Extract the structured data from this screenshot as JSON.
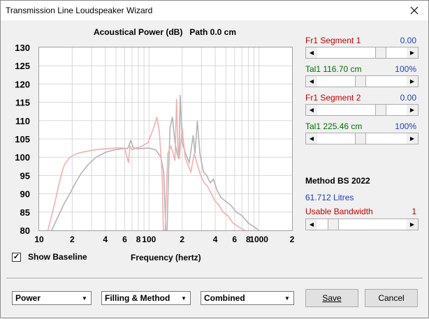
{
  "window": {
    "title": "Transmission Line Loudspeaker Wizard"
  },
  "chart_title": "Acoustical Power (dB)   Path 0.0 cm",
  "sidebar": {
    "seg1": {
      "label": "Fr1  Segment 1",
      "value": "0.00",
      "slider": 0.74
    },
    "tal1": {
      "label": "Tal1  116.70 cm",
      "value": "100%",
      "slider": 0.48
    },
    "seg2": {
      "label": "Fr1  Segment 2",
      "value": "0.00",
      "slider": 0.74
    },
    "tal2": {
      "label": "Tal1  225.46 cm",
      "value": "100%",
      "slider": 0.48
    },
    "method": "Method BS  2022",
    "litres": "61.712 Litres",
    "bandwidth": {
      "label": "Usable Bandwidth",
      "value": "1",
      "slider": 0.13
    }
  },
  "checkbox": {
    "label": "Show Baseline",
    "checked": true,
    "mark": "✓"
  },
  "xlabel": "Frequency (hertz)",
  "combos": {
    "power": "Power",
    "filling": "Filling & Method",
    "combined": "Combined"
  },
  "buttons": {
    "save": "Save",
    "cancel": "Cancel"
  },
  "icons": {
    "close": "close-icon",
    "dropdown": "dropdown-arrow-icon",
    "left": "arrow-left-icon",
    "right": "arrow-right-icon"
  },
  "colors": {
    "series_pink": "#f2b0b0",
    "series_gray": "#b4b4b4",
    "grid": "#d8d8d8"
  },
  "chart_data": {
    "type": "line",
    "title": "Acoustical Power (dB)   Path 0.0 cm",
    "xlabel": "Frequency (hertz)",
    "ylabel": "",
    "xscale": "log",
    "xlim": [
      10,
      2000
    ],
    "ylim": [
      80,
      130
    ],
    "grid": true,
    "y_ticks": [
      80,
      85,
      90,
      95,
      100,
      105,
      110,
      115,
      120,
      125,
      130
    ],
    "x_ticks": [
      {
        "value": 10,
        "label": "10"
      },
      {
        "value": 20,
        "label": "2"
      },
      {
        "value": 40,
        "label": "4"
      },
      {
        "value": 60,
        "label": "6"
      },
      {
        "value": 80,
        "label": "8"
      },
      {
        "value": 100,
        "label": "100"
      },
      {
        "value": 200,
        "label": "2"
      },
      {
        "value": 400,
        "label": "4"
      },
      {
        "value": 600,
        "label": "6"
      },
      {
        "value": 800,
        "label": "8"
      },
      {
        "value": 1000,
        "label": "1000"
      },
      {
        "value": 2000,
        "label": "2"
      }
    ],
    "series": [
      {
        "color": "#b4b4b4",
        "x": [
          13,
          15,
          17,
          19,
          21,
          24,
          28,
          33,
          40,
          48,
          57,
          64,
          68,
          72,
          78,
          88,
          100,
          115,
          128,
          136,
          142,
          146,
          150,
          155,
          163,
          172,
          180,
          187,
          192,
          200,
          215,
          232,
          252,
          262,
          275,
          290,
          312,
          335,
          360,
          385,
          415,
          450,
          495,
          550,
          620,
          700,
          800,
          900,
          1000
        ],
        "y": [
          80,
          84,
          87.5,
          90,
          92.5,
          95.5,
          98,
          100,
          101.3,
          102,
          102.3,
          102.4,
          104.5,
          102.6,
          102.3,
          102.4,
          102.5,
          102,
          100,
          96,
          80,
          80,
          94,
          108,
          111,
          104,
          101,
          99.5,
          117,
          104,
          101,
          98.5,
          106,
          101,
          110,
          101,
          96,
          95,
          93,
          94,
          91,
          89,
          88,
          87,
          85,
          84,
          82,
          81,
          80
        ]
      },
      {
        "color": "#f2b0b0",
        "x": [
          12,
          13,
          14,
          15,
          16,
          17,
          19,
          22,
          26,
          32,
          40,
          50,
          60,
          65,
          67,
          70,
          76,
          86,
          98,
          110,
          118,
          124,
          128,
          132,
          135,
          140,
          148,
          158,
          166,
          172,
          178,
          183,
          188,
          200,
          213,
          225,
          240,
          258,
          275,
          295,
          318,
          342,
          368,
          398,
          430,
          470,
          520,
          580,
          650,
          740
        ],
        "y": [
          80,
          84,
          88,
          92,
          95.5,
          98,
          100,
          101,
          101.5,
          102,
          102.3,
          102.5,
          102.5,
          98.5,
          103,
          102,
          102.5,
          103,
          104,
          108,
          111,
          107,
          101,
          94,
          80,
          80,
          101,
          103,
          101,
          99,
          116,
          102,
          99.5,
          108,
          100,
          98,
          96,
          101,
          98,
          95,
          93,
          92,
          90,
          88,
          87,
          85,
          84,
          82,
          81,
          80
        ]
      }
    ]
  }
}
